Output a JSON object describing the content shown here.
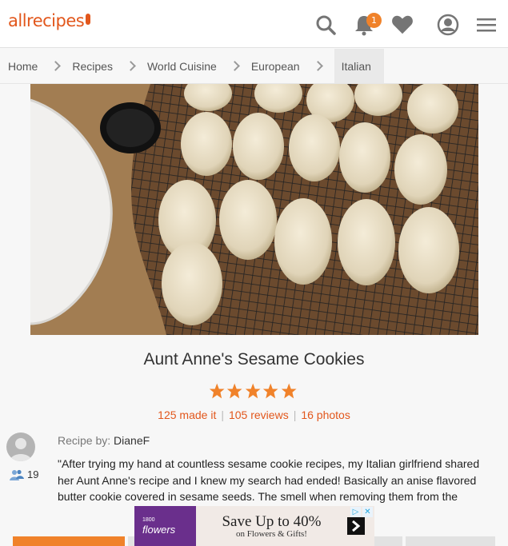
{
  "header": {
    "logo_text": "allrecipes",
    "notification_count": "1",
    "icons": [
      "search-icon",
      "bell-icon",
      "heart-icon",
      "profile-icon",
      "menu-icon"
    ],
    "accent_color": "#e2571c"
  },
  "breadcrumb": {
    "items": [
      "Home",
      "Recipes",
      "World Cuisine",
      "European",
      "Italian"
    ]
  },
  "recipe": {
    "title": "Aunt Anne's Sesame Cookies",
    "rating": 5,
    "made_it": "125 made it",
    "reviews": "105 reviews",
    "photos": "16 photos",
    "recipe_by_label": "Recipe by:",
    "author": "DianeF",
    "followers": "19",
    "description": "\"After trying my hand at countless sesame cookie recipes, my Italian girlfriend shared her Aunt Anne's recipe and I knew my search had ended! Basically an anise flavored butter cookie covered in sesame seeds. The smell when removing them from the"
  },
  "ad": {
    "brand_small": "1800",
    "brand_big": "flowers",
    "line1": "Save Up to 40%",
    "line2": "on Flowers & Gifts!"
  }
}
